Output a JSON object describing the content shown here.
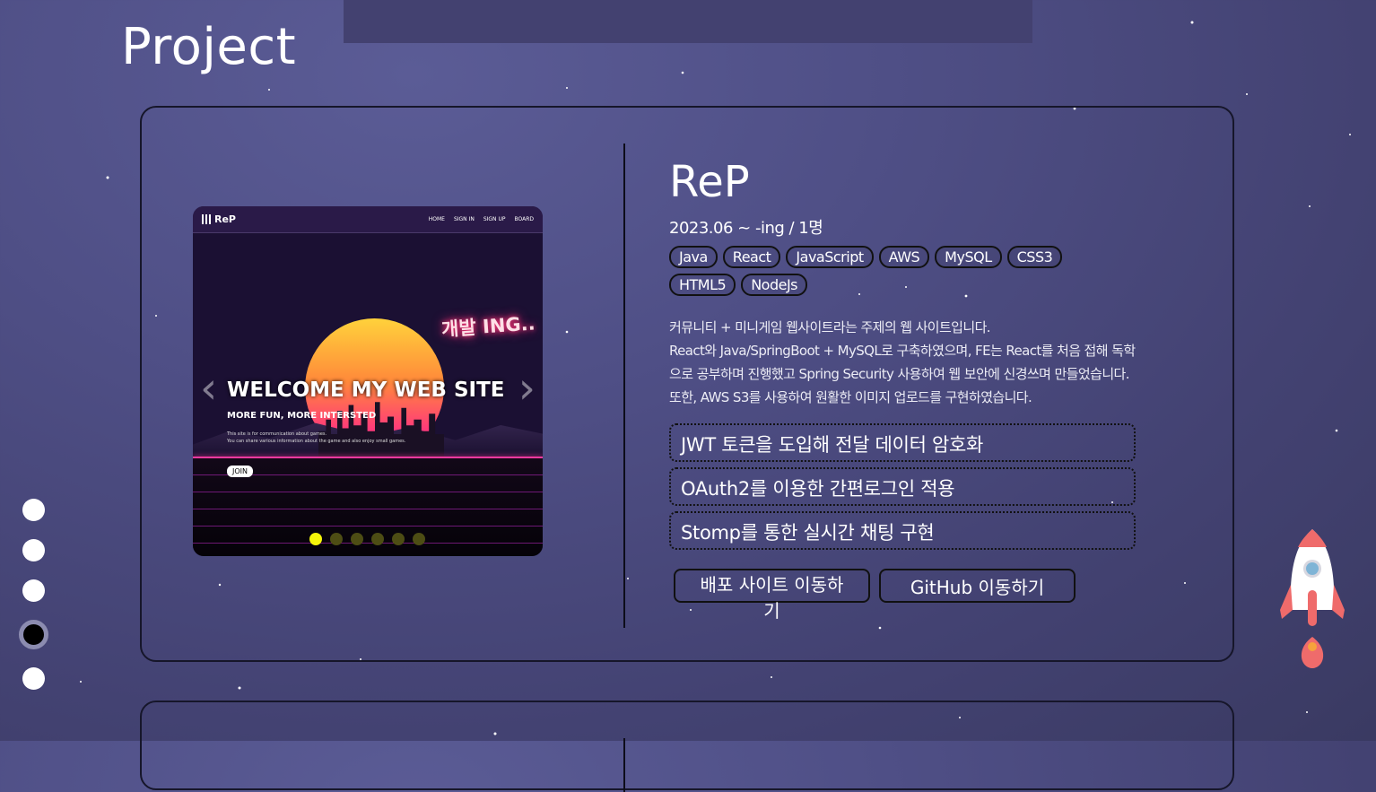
{
  "section": {
    "title": "Project"
  },
  "project": {
    "name": "ReP",
    "period_team": "2023.06 ~ -ing  /  1명",
    "tags": [
      "Java",
      "React",
      "JavaScript",
      "AWS",
      "MySQL",
      "CSS3",
      "HTML5",
      "NodeJs"
    ],
    "description": [
      "커뮤니티 + 미니게임 웹사이트라는 주제의 웹 사이트입니다.",
      "React와 Java/SpringBoot + MySQL로 구축하였으며, FE는 React를 처음 접해 독학",
      "으로 공부하며 진행했고 Spring Security 사용하여 웹 보안에 신경쓰며 만들었습니다.",
      "또한, AWS S3를 사용하여 원활한 이미지 업로드를 구현하였습니다."
    ],
    "features": [
      "JWT 토큰을 도입해 전달 데이터 암호화",
      "OAuth2를 이용한 간편로그인 적용",
      "Stomp를 통한 실시간 채팅 구현"
    ],
    "buttons": {
      "deploy": "배포 사이트 이동하기",
      "github": "GitHub 이동하기"
    }
  },
  "screenshot": {
    "logo": "ReP",
    "nav_links": [
      "HOME",
      "SIGN IN",
      "SIGN UP",
      "BOARD"
    ],
    "neon_sign": "개발 ING..",
    "headline": "WELCOME MY WEB SITE",
    "subheadline": "MORE FUN, MORE INTERSTED",
    "paragraph_1": "This site is for communication about games.",
    "paragraph_2": "You can share various information about the game and also enjoy small games.",
    "join_label": "JOIN",
    "slide_count": 6,
    "active_slide": 1,
    "prev_glyph": "‹",
    "next_glyph": "›"
  },
  "section_nav": {
    "count": 5,
    "active": 4
  },
  "colors": {
    "active_slide_dot": "#f5f50a",
    "inactive_slide_dot": "#4d4d14",
    "rocket_body": "#ffffff",
    "rocket_fin": "#f06a6a"
  },
  "icons": {
    "rocket": "rocket-icon"
  }
}
